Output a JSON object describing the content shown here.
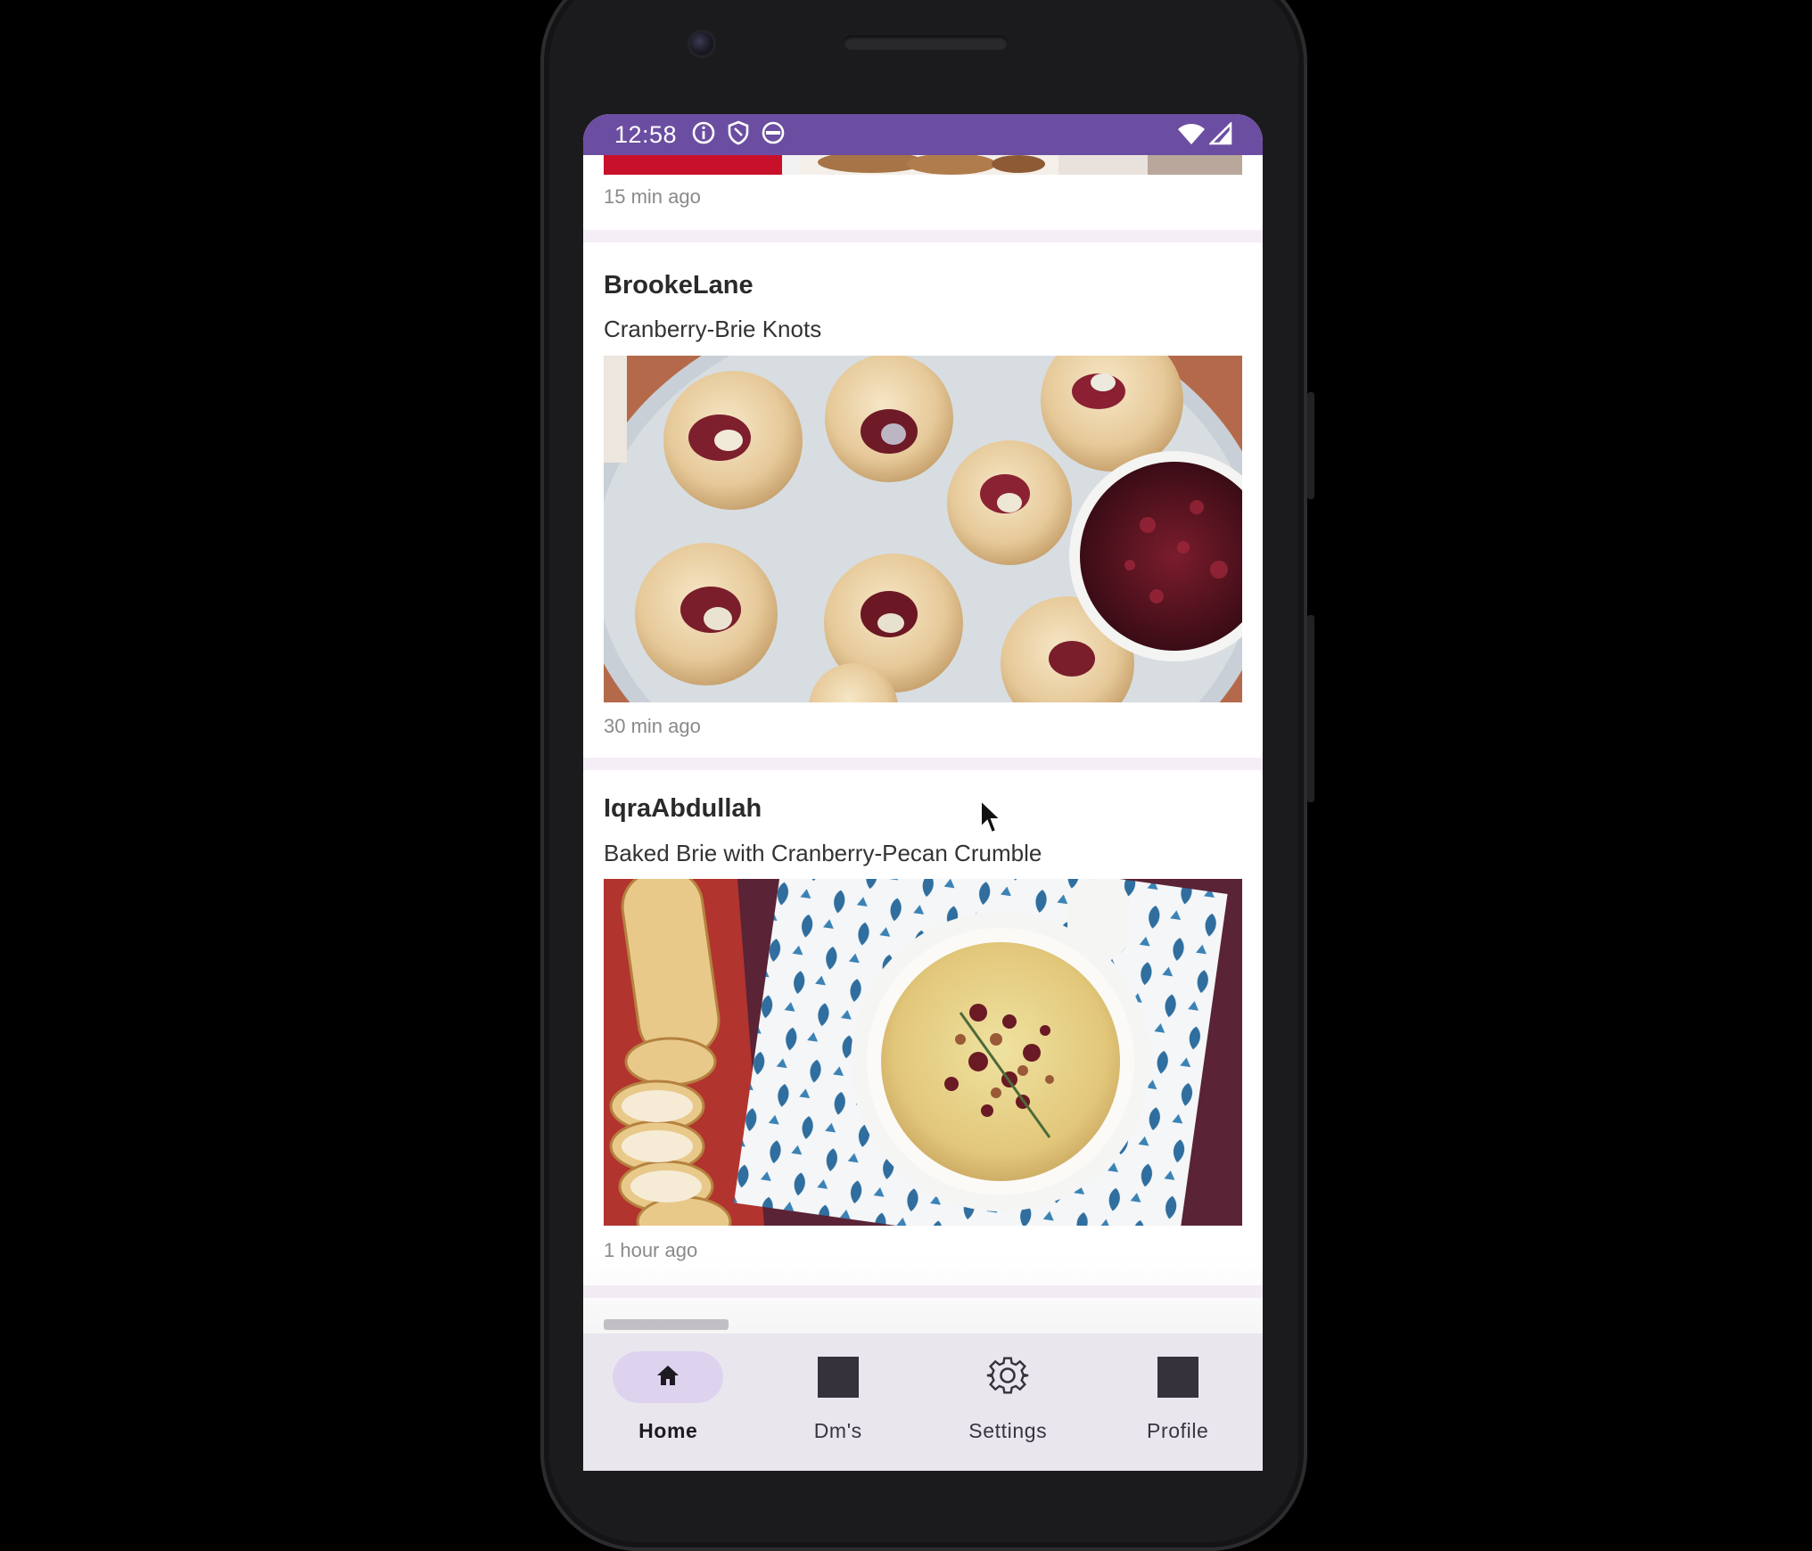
{
  "status_bar": {
    "time": "12:58",
    "left_icons": [
      "info-icon",
      "shield-icon",
      "app-icon"
    ],
    "right_icons": [
      "wifi-icon",
      "signal-icon"
    ],
    "color": "#6b4ea1"
  },
  "feed": {
    "previous_post": {
      "time_ago": "15 min ago"
    },
    "posts": [
      {
        "username": "BrookeLane",
        "title": "Cranberry-Brie Knots",
        "time_ago": "30 min ago",
        "image": "cranberry-brie-knots-photo"
      },
      {
        "username": "IqraAbdullah",
        "title": "Baked Brie with Cranberry-Pecan Crumble",
        "time_ago": "1 hour ago",
        "image": "baked-brie-photo"
      }
    ]
  },
  "bottom_nav": {
    "items": [
      {
        "label": "Home",
        "icon": "home-icon",
        "active": true
      },
      {
        "label": "Dm's",
        "icon": "square-icon",
        "active": false
      },
      {
        "label": "Settings",
        "icon": "gear-icon",
        "active": false
      },
      {
        "label": "Profile",
        "icon": "square-icon",
        "active": false
      }
    ],
    "active_color": "#ddd3ee"
  }
}
